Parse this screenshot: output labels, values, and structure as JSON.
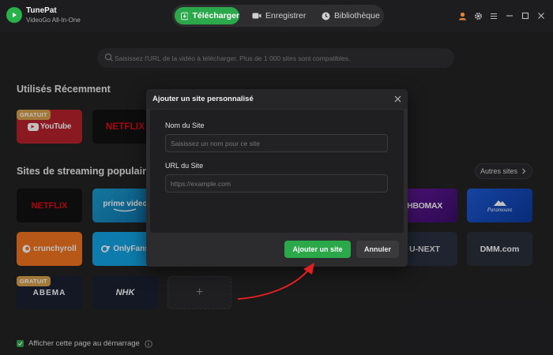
{
  "app": {
    "name": "TunePat",
    "subtitle": "VideoGo All-In-One"
  },
  "tabs": [
    {
      "label": "Télécharger",
      "icon": "download-icon",
      "active": true
    },
    {
      "label": "Enregistrer",
      "icon": "video-camera-icon",
      "active": false
    },
    {
      "label": "Bibliothèque",
      "icon": "clock-icon",
      "active": false
    }
  ],
  "window_controls": [
    "account-icon",
    "settings-icon",
    "menu-icon",
    "minimize-icon",
    "maximize-icon",
    "close-icon"
  ],
  "search": {
    "placeholder": "Saisissez l'URL de la vidéo à télécharger. Plus de 1 000 sites sont compatibles."
  },
  "recent": {
    "title": "Utilisés Récemment",
    "tiles": [
      {
        "brand": "YouTube",
        "badge": "GRATUIT"
      },
      {
        "brand": "NETFLIX"
      }
    ]
  },
  "popular": {
    "title": "Sites de streaming populaires",
    "more_label": "Autres sites",
    "row1": [
      {
        "brand": "NETFLIX"
      },
      {
        "brand": "prime video"
      },
      {
        "brand": "HBOMAX"
      },
      {
        "brand": "Paramount"
      }
    ],
    "row2": [
      {
        "brand": "crunchyroll"
      },
      {
        "brand": "OnlyFans"
      },
      {
        "brand": "U-NEXT"
      },
      {
        "brand": "DMM.com"
      }
    ],
    "row3": [
      {
        "brand": "ABEMA",
        "badge": "GRATUIT"
      },
      {
        "brand": "NHK"
      }
    ],
    "add_symbol": "+"
  },
  "footer": {
    "checkbox_label": "Afficher cette page au démarrage",
    "checked": true
  },
  "modal": {
    "title": "Ajouter un site personnalisé",
    "name_label": "Nom du Site",
    "name_placeholder": "Saisissez un nom pour ce site",
    "url_label": "URL du Site",
    "url_placeholder": "https://example.com",
    "confirm_label": "Ajouter un site",
    "cancel_label": "Annuler"
  },
  "colors": {
    "accent": "#2aa84a",
    "badge": "#d9a24d",
    "arrow": "#e02020"
  }
}
